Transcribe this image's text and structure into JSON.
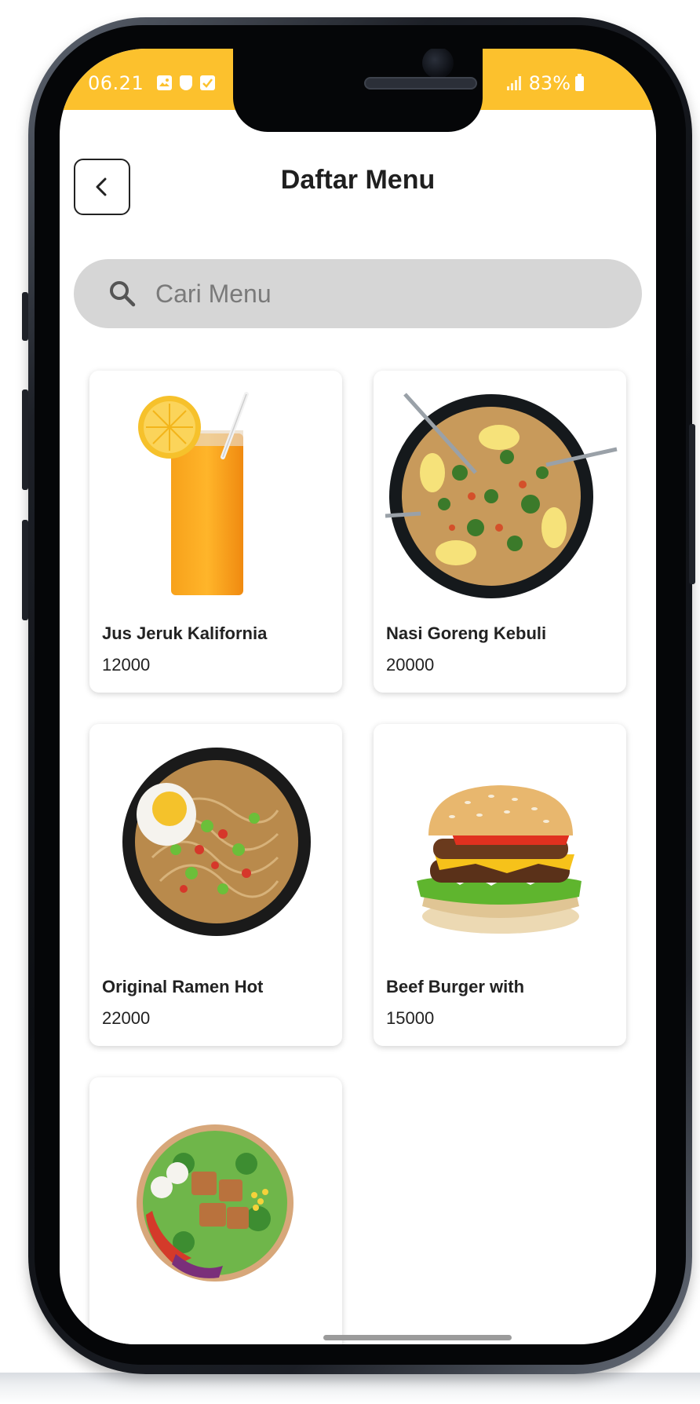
{
  "status_bar": {
    "time": "06.21",
    "battery": "83%",
    "icons": [
      "image-icon",
      "shield-icon",
      "checkbox-icon",
      "signal-icon",
      "battery-icon"
    ]
  },
  "header": {
    "title": "Daftar Menu",
    "back_icon": "chevron-left-icon"
  },
  "search": {
    "placeholder": "Cari Menu",
    "value": ""
  },
  "menu_items": [
    {
      "name": "Jus Jeruk Kalifornia",
      "price": "12000",
      "image": "orange-juice"
    },
    {
      "name": "Nasi Goreng Kebuli",
      "price": "20000",
      "image": "fried-rice"
    },
    {
      "name": "Original Ramen Hot",
      "price": "22000",
      "image": "ramen-bowl"
    },
    {
      "name": "Beef Burger with",
      "price": "15000",
      "image": "beef-burger"
    },
    {
      "name": "",
      "price": "",
      "image": "salad-bowl"
    }
  ],
  "colors": {
    "status_bar": "#fcc12d",
    "search_background": "#d6d6d6",
    "card_background": "#ffffff"
  }
}
